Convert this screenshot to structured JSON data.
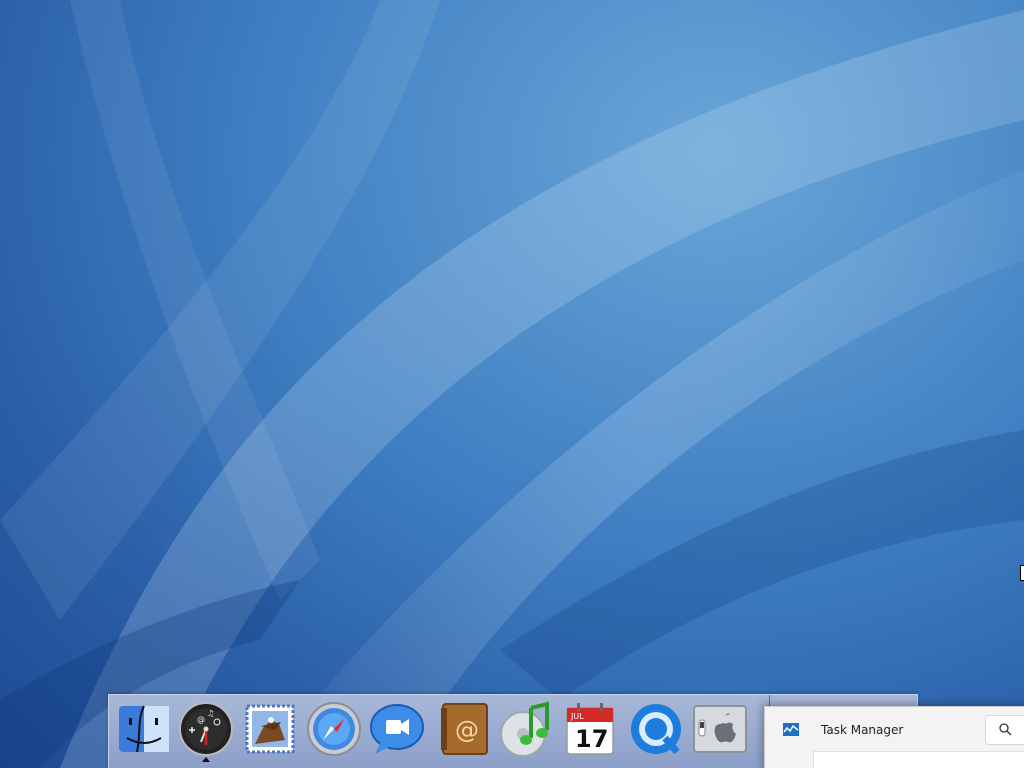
{
  "desktop": {
    "wallpaper": "aqua-blue-swooshes"
  },
  "dock": {
    "items": [
      {
        "name": "finder-icon",
        "icon": "finder"
      },
      {
        "name": "dashboard-icon",
        "icon": "dashboard",
        "running": true
      },
      {
        "name": "mail-icon",
        "icon": "mail"
      },
      {
        "name": "safari-icon",
        "icon": "safari"
      },
      {
        "name": "ichat-icon",
        "icon": "ichat"
      },
      {
        "name": "address-book-icon",
        "icon": "address-book"
      },
      {
        "name": "itunes-icon",
        "icon": "itunes"
      },
      {
        "name": "ical-icon",
        "icon": "ical",
        "month": "JUL",
        "day": "17"
      },
      {
        "name": "quicktime-icon",
        "icon": "quicktime"
      },
      {
        "name": "system-preferences-icon",
        "icon": "system-preferences"
      }
    ]
  },
  "taskmgr": {
    "title": "Task Manager",
    "search_icon": "search-icon"
  },
  "colors": {
    "wallpaper_dark": "#1d4a91",
    "wallpaper_light": "#6aa6d8",
    "dock_bg": "#9aaed2"
  }
}
